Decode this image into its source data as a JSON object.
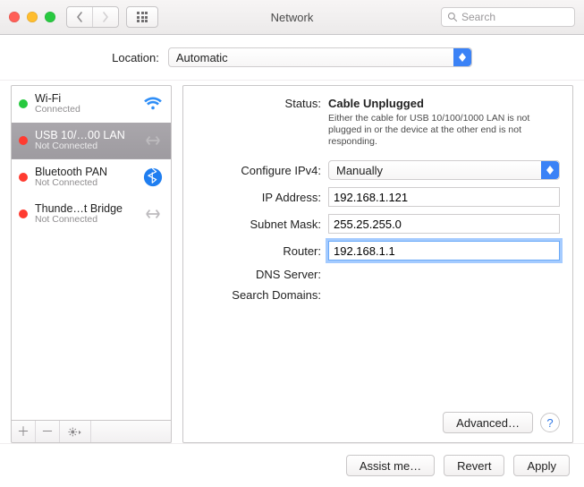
{
  "titlebar": {
    "title": "Network",
    "search_placeholder": "Search"
  },
  "location": {
    "label": "Location:",
    "value": "Automatic"
  },
  "sidebar": {
    "items": [
      {
        "name": "Wi-Fi",
        "status": "Connected",
        "dot": "green",
        "icon": "wifi-icon",
        "selected": false
      },
      {
        "name": "USB 10/…00 LAN",
        "status": "Not Connected",
        "dot": "red",
        "icon": "usb-lan-icon",
        "selected": true
      },
      {
        "name": "Bluetooth PAN",
        "status": "Not Connected",
        "dot": "red",
        "icon": "bluetooth-icon",
        "selected": false
      },
      {
        "name": "Thunde…t Bridge",
        "status": "Not Connected",
        "dot": "red",
        "icon": "thunderbolt-bridge-icon",
        "selected": false
      }
    ]
  },
  "details": {
    "status_label": "Status:",
    "status_value": "Cable Unplugged",
    "status_description": "Either the cable for USB 10/100/1000 LAN is not plugged in or the device at the other end is not responding.",
    "configure_ipv4_label": "Configure IPv4:",
    "configure_ipv4_value": "Manually",
    "ip_address_label": "IP Address:",
    "ip_address_value": "192.168.1.121",
    "subnet_mask_label": "Subnet Mask:",
    "subnet_mask_value": "255.25.255.0",
    "router_label": "Router:",
    "router_value": "192.168.1.1",
    "dns_server_label": "DNS Server:",
    "search_domains_label": "Search Domains:",
    "advanced_label": "Advanced…"
  },
  "footer": {
    "assist_label": "Assist me…",
    "revert_label": "Revert",
    "apply_label": "Apply"
  }
}
